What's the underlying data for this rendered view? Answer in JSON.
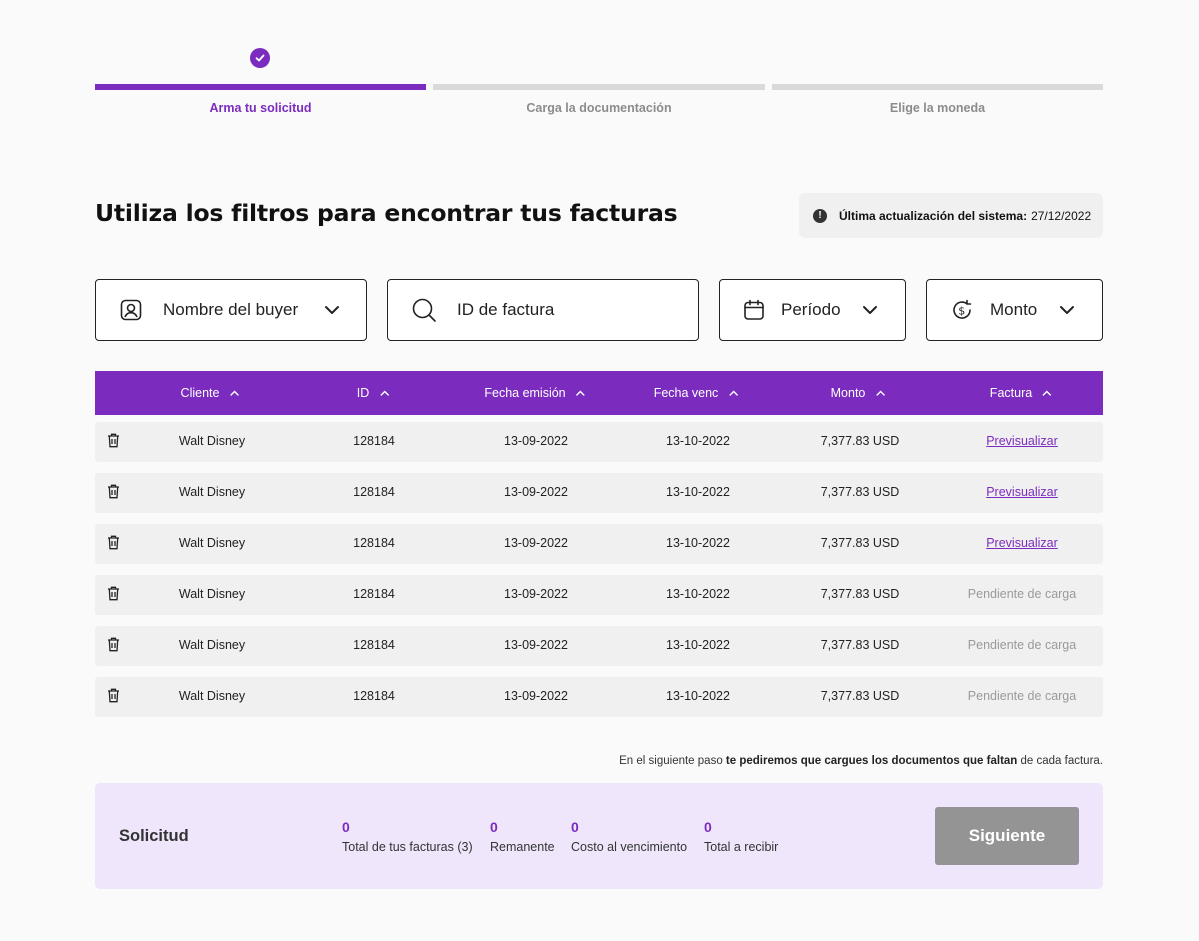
{
  "stepper": {
    "steps": [
      {
        "label": "Arma tu solicitud"
      },
      {
        "label": "Carga la documentación"
      },
      {
        "label": "Elige la moneda"
      }
    ]
  },
  "header": {
    "title": "Utiliza los filtros para encontrar tus facturas",
    "update_label": "Última actualización del sistema:",
    "update_date": "27/12/2022"
  },
  "filters": {
    "buyer": "Nombre del buyer",
    "invoice_id_placeholder": "ID de factura",
    "period": "Período",
    "amount": "Monto"
  },
  "table": {
    "columns": [
      "Cliente",
      "ID",
      "Fecha emisión",
      "Fecha venc",
      "Monto",
      "Factura"
    ],
    "rows": [
      {
        "cliente": "Walt Disney",
        "id": "128184",
        "emision": "13-09-2022",
        "venc": "13-10-2022",
        "monto": "7,377.83 USD",
        "factura": "Previsualizar"
      },
      {
        "cliente": "Walt Disney",
        "id": "128184",
        "emision": "13-09-2022",
        "venc": "13-10-2022",
        "monto": "7,377.83 USD",
        "factura": "Previsualizar"
      },
      {
        "cliente": "Walt Disney",
        "id": "128184",
        "emision": "13-09-2022",
        "venc": "13-10-2022",
        "monto": "7,377.83 USD",
        "factura": "Previsualizar"
      },
      {
        "cliente": "Walt Disney",
        "id": "128184",
        "emision": "13-09-2022",
        "venc": "13-10-2022",
        "monto": "7,377.83 USD",
        "factura": "Pendiente de carga"
      },
      {
        "cliente": "Walt Disney",
        "id": "128184",
        "emision": "13-09-2022",
        "venc": "13-10-2022",
        "monto": "7,377.83 USD",
        "factura": "Pendiente de carga"
      },
      {
        "cliente": "Walt Disney",
        "id": "128184",
        "emision": "13-09-2022",
        "venc": "13-10-2022",
        "monto": "7,377.83 USD",
        "factura": "Pendiente de carga"
      }
    ]
  },
  "note": {
    "prefix": "En el siguiente paso ",
    "bold": "te pediremos que cargues los documentos que faltan",
    "suffix": " de cada factura."
  },
  "summary": {
    "title": "Solicitud",
    "metrics": [
      {
        "value": "0",
        "label": "Total de tus facturas (3)"
      },
      {
        "value": "0",
        "label": "Remanente"
      },
      {
        "value": "0",
        "label": "Costo al vencimiento"
      },
      {
        "value": "0",
        "label": "Total a recibir"
      }
    ],
    "next_label": "Siguiente"
  },
  "colors": {
    "accent": "#7b2cbf",
    "summary_bg": "#efe6fb",
    "disabled_button": "#949494"
  }
}
